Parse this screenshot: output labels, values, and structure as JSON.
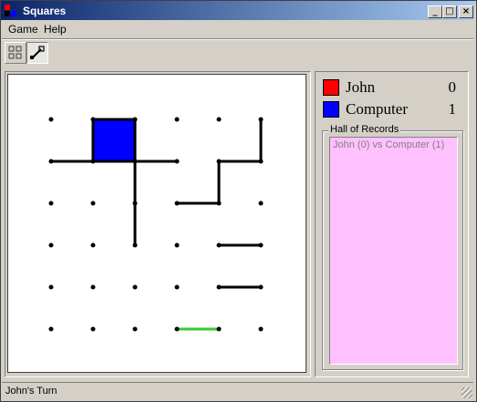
{
  "window": {
    "title": "Squares",
    "controls": {
      "minimize": "_",
      "maximize": "□",
      "close": "×"
    }
  },
  "menu": {
    "items": [
      "Game",
      "Help"
    ]
  },
  "toolbar": {
    "buttons": [
      {
        "icon": "new-game-icon"
      },
      {
        "icon": "settings-icon",
        "pressed": true
      }
    ]
  },
  "board": {
    "grid_size": 6,
    "dot_color": "#000000",
    "line_color": "#000000",
    "highlight_color": "#33cc33",
    "lines": [
      {
        "from": [
          1,
          0
        ],
        "to": [
          2,
          0
        ]
      },
      {
        "from": [
          1,
          0
        ],
        "to": [
          1,
          1
        ]
      },
      {
        "from": [
          2,
          0
        ],
        "to": [
          2,
          1
        ]
      },
      {
        "from": [
          0,
          1
        ],
        "to": [
          1,
          1
        ]
      },
      {
        "from": [
          1,
          1
        ],
        "to": [
          2,
          1
        ]
      },
      {
        "from": [
          2,
          1
        ],
        "to": [
          3,
          1
        ]
      },
      {
        "from": [
          2,
          1
        ],
        "to": [
          2,
          3
        ]
      },
      {
        "from": [
          5,
          0
        ],
        "to": [
          5,
          1
        ]
      },
      {
        "from": [
          4,
          1
        ],
        "to": [
          5,
          1
        ]
      },
      {
        "from": [
          4,
          1
        ],
        "to": [
          4,
          2
        ]
      },
      {
        "from": [
          3,
          2
        ],
        "to": [
          4,
          2
        ]
      },
      {
        "from": [
          4,
          3
        ],
        "to": [
          5,
          3
        ]
      },
      {
        "from": [
          4,
          4
        ],
        "to": [
          5,
          4
        ]
      }
    ],
    "last_line": {
      "from": [
        3,
        5
      ],
      "to": [
        4,
        5
      ]
    },
    "filled_boxes": [
      {
        "col": 1,
        "row": 0,
        "owner": "Computer",
        "color": "#0000ff"
      }
    ]
  },
  "players": [
    {
      "name": "John",
      "score": "0",
      "color": "#ff0000"
    },
    {
      "name": "Computer",
      "score": "1",
      "color": "#0000ff"
    }
  ],
  "hall_of_records": {
    "label": "Hall of Records",
    "background": "#ffc0ff",
    "entries": [
      "John (0) vs Computer (1)"
    ]
  },
  "status": {
    "text": "John's Turn"
  }
}
